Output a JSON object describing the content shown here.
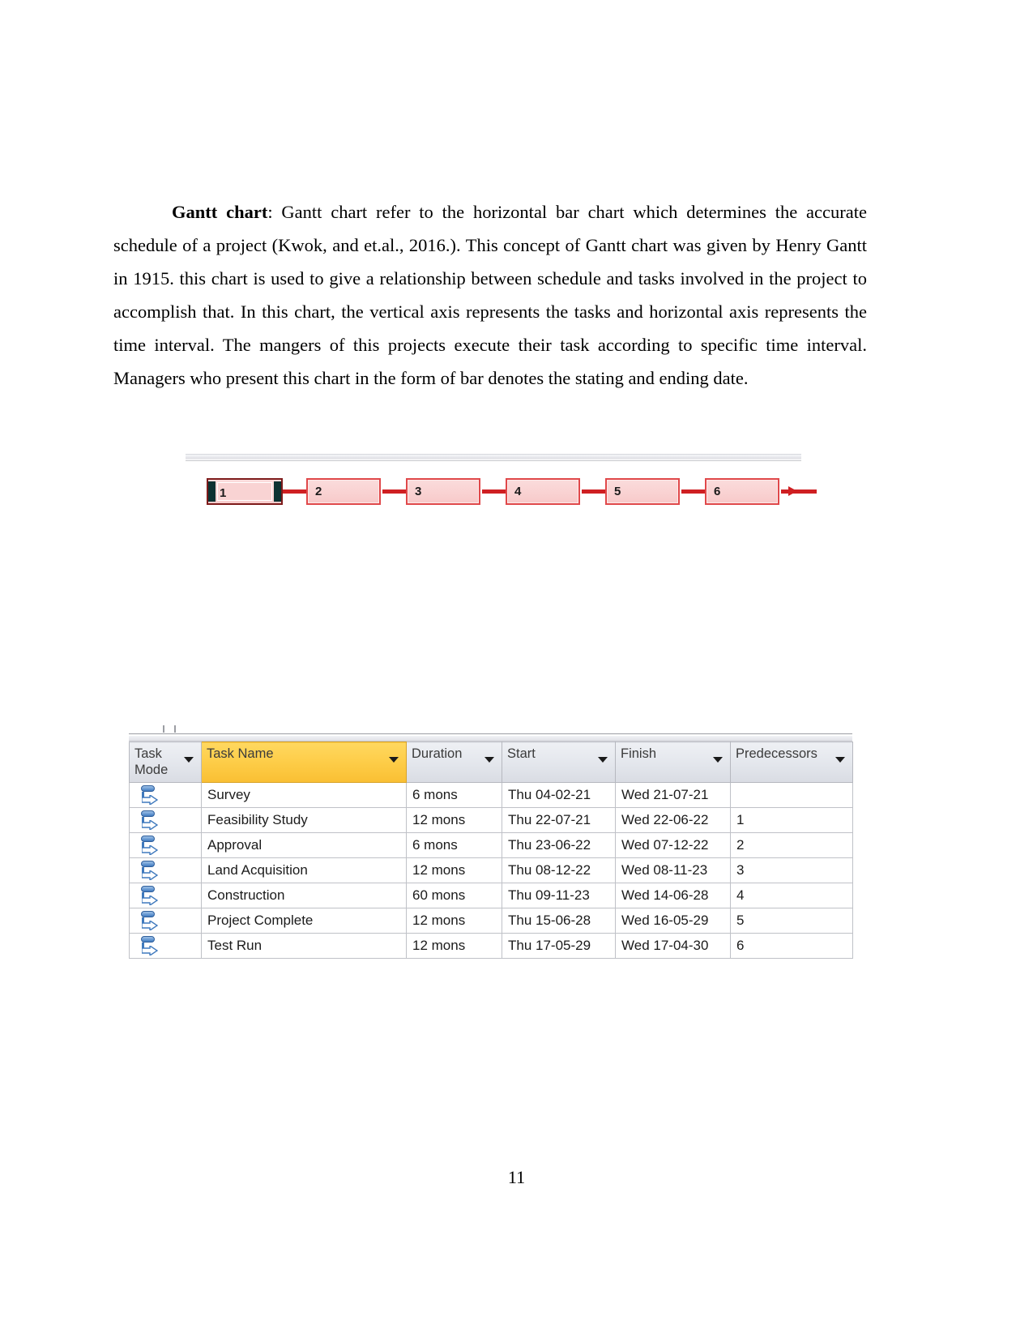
{
  "document": {
    "paragraph": {
      "lead_term": "Gantt chart",
      "text": ": Gantt chart refer to the horizontal bar chart which determines the accurate schedule of a project (Kwok, and et.al., 2016.). This concept of Gantt chart was given by Henry Gantt in 1915. this chart is used to give a relationship between schedule and tasks involved in the project to accomplish that. In this chart, the vertical axis represents the tasks and horizontal axis represents the time interval. The mangers of this projects execute their task according to specific time interval. Managers who present this chart in the form of bar denotes the stating and ending date."
    },
    "page_number": "11"
  },
  "network_diagram": {
    "nodes": [
      {
        "label": "1",
        "selected": true
      },
      {
        "label": "2",
        "selected": false
      },
      {
        "label": "3",
        "selected": false
      },
      {
        "label": "4",
        "selected": false
      },
      {
        "label": "5",
        "selected": false
      },
      {
        "label": "6",
        "selected": false
      }
    ],
    "colors": {
      "node_fill": "#f9d2d2",
      "node_border": "#e0484a",
      "link": "#cf1f22",
      "selection_handle": "#0d3333"
    }
  },
  "project_table": {
    "columns": [
      {
        "label": "Task Mode",
        "highlighted": false
      },
      {
        "label": "Task Name",
        "highlighted": true
      },
      {
        "label": "Duration",
        "highlighted": false
      },
      {
        "label": "Start",
        "highlighted": false
      },
      {
        "label": "Finish",
        "highlighted": false
      },
      {
        "label": "Predecessors",
        "highlighted": false
      }
    ],
    "rows": [
      {
        "mode_icon": "auto-scheduled-icon",
        "name": "Survey",
        "duration": "6 mons",
        "start": "Thu 04-02-21",
        "finish": "Wed 21-07-21",
        "predecessors": ""
      },
      {
        "mode_icon": "auto-scheduled-icon",
        "name": "Feasibility Study",
        "duration": "12 mons",
        "start": "Thu 22-07-21",
        "finish": "Wed 22-06-22",
        "predecessors": "1"
      },
      {
        "mode_icon": "auto-scheduled-icon",
        "name": "Approval",
        "duration": "6 mons",
        "start": "Thu 23-06-22",
        "finish": "Wed 07-12-22",
        "predecessors": "2"
      },
      {
        "mode_icon": "auto-scheduled-icon",
        "name": "Land Acquisition",
        "duration": "12 mons",
        "start": "Thu 08-12-22",
        "finish": "Wed 08-11-23",
        "predecessors": "3"
      },
      {
        "mode_icon": "auto-scheduled-icon",
        "name": "Construction",
        "duration": "60 mons",
        "start": "Thu 09-11-23",
        "finish": "Wed 14-06-28",
        "predecessors": "4"
      },
      {
        "mode_icon": "auto-scheduled-icon",
        "name": "Project Complete",
        "duration": "12 mons",
        "start": "Thu 15-06-28",
        "finish": "Wed 16-05-29",
        "predecessors": "5"
      },
      {
        "mode_icon": "auto-scheduled-icon",
        "name": "Test Run",
        "duration": "12 mons",
        "start": "Thu 17-05-29",
        "finish": "Wed 17-04-30",
        "predecessors": "6"
      }
    ],
    "colors": {
      "header_bg": "#e3e6ec",
      "header_highlight_bg": "#fdcb45",
      "grid_border": "#bfc1c7",
      "mode_icon": "#3f79bd"
    }
  }
}
